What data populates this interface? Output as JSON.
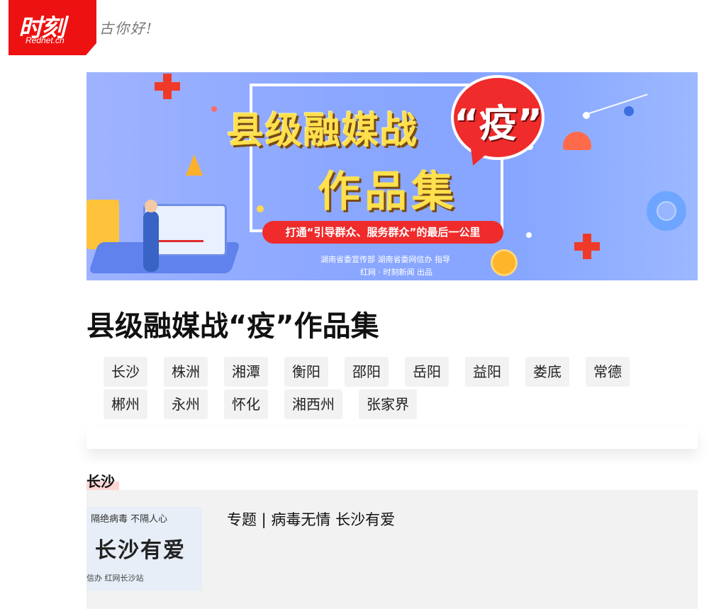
{
  "header": {
    "brand_logo_text": "时刻",
    "brand_logo_sub": "Rednet.cn",
    "signature_text": "古你好!"
  },
  "banner": {
    "title_part1": "县级融媒战",
    "title_quote": "“疫”",
    "title_part2": "作品集",
    "slogan": "打通“引导群众、服务群众”的最后一公里",
    "sponsor_line1": "湖南省委宣传部  湖南省委网信办  指导",
    "sponsor_line2": "红网 · 时刻新闻  出品"
  },
  "page_title": "县级融媒战“疫”作品集",
  "regions": [
    "长沙",
    "株洲",
    "湘潭",
    "衡阳",
    "邵阳",
    "岳阳",
    "益阳",
    "娄底",
    "常德",
    "郴州",
    "永州",
    "怀化",
    "湘西州",
    "张家界"
  ],
  "section": {
    "title": "长沙",
    "cards": [
      {
        "thumb_line1": "隔绝病毒  不隔人心",
        "thumb_line2": "长沙有爱",
        "thumb_line3": "信办  红网长沙站",
        "title": "专题 | 病毒无情 长沙有爱"
      }
    ]
  }
}
